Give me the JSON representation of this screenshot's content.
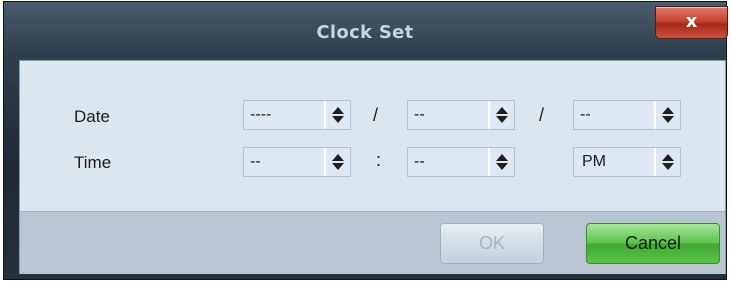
{
  "dialog": {
    "title": "Clock Set",
    "close_label": "x"
  },
  "fields": {
    "date": {
      "label": "Date",
      "year": "----",
      "sep1": "/",
      "month": "--",
      "sep2": "/",
      "day": "--"
    },
    "time": {
      "label": "Time",
      "hour": "--",
      "sep": ":",
      "minute": "--",
      "ampm": "PM"
    }
  },
  "buttons": {
    "ok": "OK",
    "cancel": "Cancel"
  },
  "colors": {
    "close_button": "#c84432",
    "cancel_button": "#5fc34f",
    "content_bg": "#dce6ee",
    "footer_bg": "#b9c6d1"
  },
  "icons": {
    "spinner": "up-down-arrows-icon",
    "close": "close-icon"
  }
}
